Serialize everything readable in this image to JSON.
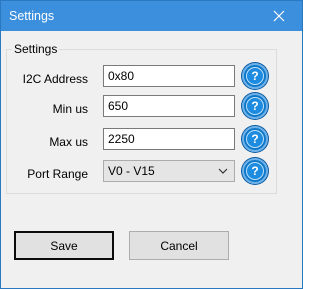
{
  "window": {
    "title": "Settings"
  },
  "group": {
    "legend": "Settings"
  },
  "fields": {
    "i2c_label": "I2C Address",
    "i2c_value": "0x80",
    "min_label": "Min us",
    "min_value": "650",
    "max_label": "Max us",
    "max_value": "2250",
    "port_label": "Port Range",
    "port_value": "V0 - V15"
  },
  "help": {
    "glyph": "?"
  },
  "buttons": {
    "save_label": "Save",
    "cancel_label": "Cancel"
  },
  "colors": {
    "titlebar": "#3c8fdd",
    "help_icon": "#0e78c8"
  }
}
